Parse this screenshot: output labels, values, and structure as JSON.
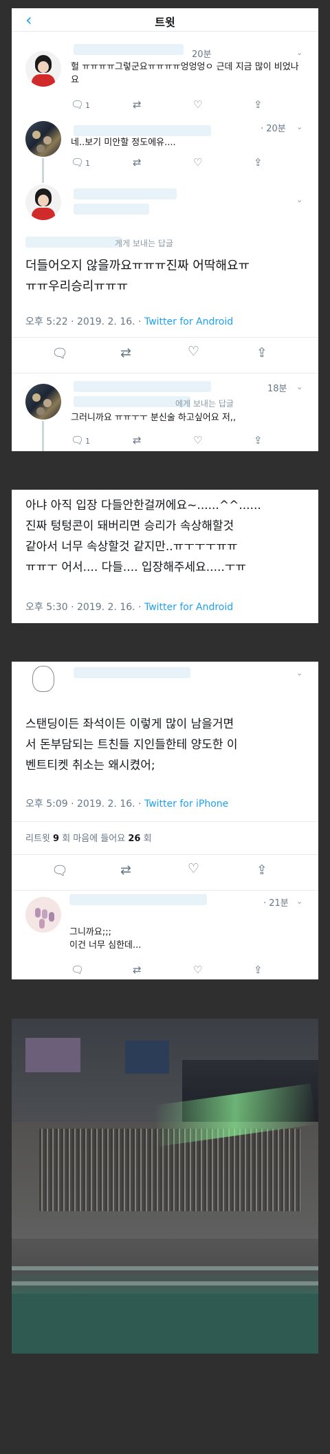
{
  "header": {
    "title": "트윗",
    "back_icon": "chevron-left-icon"
  },
  "replies_top": [
    {
      "time": "20분",
      "text": "헐 ㅠㅠㅠㅠ그렇군요ㅠㅠㅠㅠ엉엉엉ㅇ 근데 지금 많이 비었나요",
      "reply_count": "1"
    },
    {
      "time": "· 20분",
      "text": "네..보기 미안할 정도에유....",
      "reply_count": "1"
    }
  ],
  "main_tweet_1": {
    "replying_to": "게게 보내는 답글",
    "text": "더들어오지 않을까요ㅠㅠㅠ진짜 어딱해요ㅠ\nㅠㅠ우리승리ㅠㅠㅠ",
    "timestamp": "오후 5:22 · 2019. 2. 16. · ",
    "source": "Twitter for Android"
  },
  "reply_after_1": {
    "time": "18분",
    "replying_to": "에게 보내는 답글",
    "text": "그러니까요 ㅠㅠㅜㅜ 분신술 하고싶어요 저,,",
    "reply_count": "1"
  },
  "tweet_2": {
    "text": "아냐 아직 입장 다들안한걸꺼에요~......^^......\n진짜 텅텅콘이 돼버리면 승리가 속상해할것\n같아서 너무 속상할것 같지만..ㅠㅜㅜㅜㅠㅠ\nㅠㅠㅜ 어서.... 다들.... 입장해주세요.....ㅜㅠ",
    "timestamp": "오후 5:30 · 2019. 2. 16. · ",
    "source": "Twitter for Android"
  },
  "tweet_3": {
    "text": "스탠딩이든 좌석이든 이렇게 많이 남을거면\n서 돈부담되는 트친들 지인들한테 양도한 이\n벤트티켓 취소는 왜시켰어;",
    "timestamp": "오후 5:09 · 2019. 2. 16. · ",
    "source": "Twitter for iPhone",
    "stats": {
      "retweet_label": "리트윗",
      "retweet_count": "9",
      "like_label": "회  마음에 들어요",
      "like_count": "26",
      "like_suffix": "회"
    }
  },
  "reply_after_3": {
    "time": "· 21분",
    "text": "그니까요;;;\n이건 너무 심한데..."
  },
  "colors": {
    "accent": "#1da1f2",
    "muted": "#657786",
    "background": "#2f2f2f"
  },
  "icons": [
    "chevron-left-icon",
    "chevron-down-icon",
    "reply-icon",
    "retweet-icon",
    "like-icon",
    "share-icon"
  ]
}
